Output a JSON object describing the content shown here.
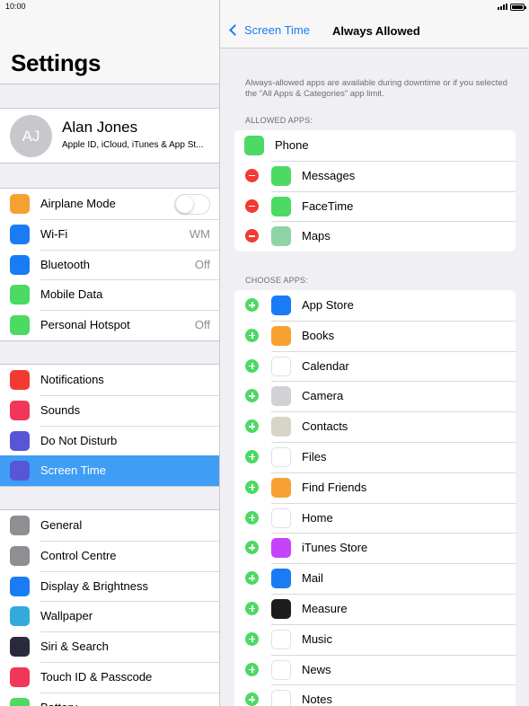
{
  "status": {
    "time": "10:00"
  },
  "sidebar": {
    "title": "Settings",
    "profile": {
      "initials": "AJ",
      "name": "Alan Jones",
      "subtitle": "Apple ID, iCloud, iTunes & App St..."
    },
    "groups": [
      [
        {
          "name": "airplane-mode",
          "label": "Airplane Mode",
          "icon": "airplane-icon",
          "color": "#f7a032",
          "toggle": false
        },
        {
          "name": "wifi",
          "label": "Wi-Fi",
          "value": "WM",
          "icon": "wifi-icon",
          "color": "#1a7cf5"
        },
        {
          "name": "bluetooth",
          "label": "Bluetooth",
          "value": "Off",
          "icon": "bluetooth-icon",
          "color": "#1a7cf5"
        },
        {
          "name": "mobile-data",
          "label": "Mobile Data",
          "icon": "antenna-icon",
          "color": "#4cd964"
        },
        {
          "name": "personal-hotspot",
          "label": "Personal Hotspot",
          "value": "Off",
          "icon": "hotspot-icon",
          "color": "#4cd964"
        }
      ],
      [
        {
          "name": "notifications",
          "label": "Notifications",
          "icon": "notifications-icon",
          "color": "#f23a33"
        },
        {
          "name": "sounds",
          "label": "Sounds",
          "icon": "speaker-icon",
          "color": "#f2365a"
        },
        {
          "name": "do-not-disturb",
          "label": "Do Not Disturb",
          "icon": "moon-icon",
          "color": "#5856d6"
        },
        {
          "name": "screen-time",
          "label": "Screen Time",
          "icon": "hourglass-icon",
          "color": "#5856d6",
          "selected": true
        }
      ],
      [
        {
          "name": "general",
          "label": "General",
          "icon": "gear-icon",
          "color": "#8e8e93"
        },
        {
          "name": "control-centre",
          "label": "Control Centre",
          "icon": "switches-icon",
          "color": "#8e8e93"
        },
        {
          "name": "display-brightness",
          "label": "Display & Brightness",
          "icon": "text-size-icon",
          "color": "#1a7cf5"
        },
        {
          "name": "wallpaper",
          "label": "Wallpaper",
          "icon": "flower-icon",
          "color": "#34aadc"
        },
        {
          "name": "siri-search",
          "label": "Siri & Search",
          "icon": "siri-icon",
          "color": "#2a2a3e"
        },
        {
          "name": "touch-id-passcode",
          "label": "Touch ID & Passcode",
          "icon": "fingerprint-icon",
          "color": "#f2365a"
        },
        {
          "name": "battery",
          "label": "Battery",
          "icon": "battery-icon",
          "color": "#4cd964"
        }
      ]
    ]
  },
  "detail": {
    "back_label": "Screen Time",
    "title": "Always Allowed",
    "description": "Always-allowed apps are available during downtime or if you selected the “All Apps & Categories” app limit.",
    "allowed_header": "ALLOWED APPS:",
    "allowed_apps": [
      {
        "name": "phone",
        "label": "Phone",
        "icon": "phone-icon",
        "color": "#4cd964",
        "removable": false
      },
      {
        "name": "messages",
        "label": "Messages",
        "icon": "messages-icon",
        "color": "#4cd964",
        "removable": true
      },
      {
        "name": "facetime",
        "label": "FaceTime",
        "icon": "video-camera-icon",
        "color": "#4cd964",
        "removable": true
      },
      {
        "name": "maps",
        "label": "Maps",
        "icon": "map-icon",
        "color": "#8fd3a6",
        "removable": true
      }
    ],
    "choose_header": "CHOOSE APPS:",
    "choose_apps": [
      {
        "name": "app-store",
        "label": "App Store",
        "icon": "app-store-icon",
        "color": "#1a7cf5"
      },
      {
        "name": "books",
        "label": "Books",
        "icon": "book-icon",
        "color": "#f7a032"
      },
      {
        "name": "calendar",
        "label": "Calendar",
        "icon": "calendar-icon",
        "color": "#ffffff"
      },
      {
        "name": "camera",
        "label": "Camera",
        "icon": "camera-icon",
        "color": "#d1d1d6"
      },
      {
        "name": "contacts",
        "label": "Contacts",
        "icon": "contacts-icon",
        "color": "#d8d4c8"
      },
      {
        "name": "files",
        "label": "Files",
        "icon": "folder-icon",
        "color": "#ffffff"
      },
      {
        "name": "find-friends",
        "label": "Find Friends",
        "icon": "friends-icon",
        "color": "#f7a032"
      },
      {
        "name": "home",
        "label": "Home",
        "icon": "house-icon",
        "color": "#ffffff"
      },
      {
        "name": "itunes-store",
        "label": "iTunes Store",
        "icon": "star-icon",
        "color": "#c643fc"
      },
      {
        "name": "mail",
        "label": "Mail",
        "icon": "envelope-icon",
        "color": "#1a7cf5"
      },
      {
        "name": "measure",
        "label": "Measure",
        "icon": "ruler-icon",
        "color": "#1c1c1e"
      },
      {
        "name": "music",
        "label": "Music",
        "icon": "music-note-icon",
        "color": "#ffffff"
      },
      {
        "name": "news",
        "label": "News",
        "icon": "news-icon",
        "color": "#ffffff"
      },
      {
        "name": "notes",
        "label": "Notes",
        "icon": "notes-icon",
        "color": "#ffffff"
      }
    ]
  }
}
